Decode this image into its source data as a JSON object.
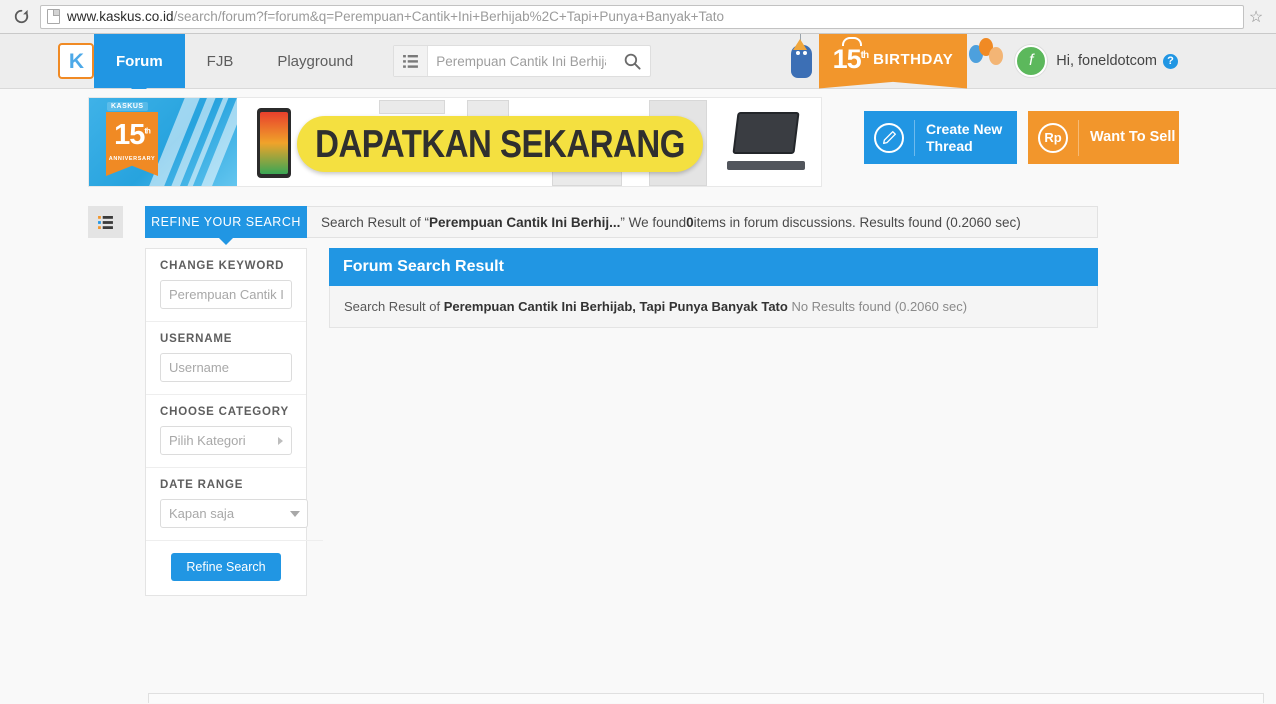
{
  "browser": {
    "reload_icon": "reload-icon",
    "page_icon": "page-icon",
    "url_domain": "www.kaskus.co.id",
    "url_path": "/search/forum?f=forum&q=Perempuan+Cantik+Ini+Berhijab%2C+Tapi+Punya+Banyak+Tato",
    "bookmark_icon": "star-icon"
  },
  "header": {
    "logo": "kaskus-logo",
    "logo_letter": "K",
    "tabs": [
      {
        "label": "Forum",
        "active": true
      },
      {
        "label": "FJB",
        "active": false
      },
      {
        "label": "Playground",
        "active": false
      }
    ],
    "category_icon": "list-icon",
    "search": {
      "placeholder": "Perempuan Cantik Ini Berhija",
      "value": "",
      "submit_icon": "search-icon"
    },
    "mascot_icon": "mascot-icon",
    "birthday": {
      "number": "15",
      "ordinal": "th",
      "word": "BIRTHDAY"
    },
    "balloons_icon": "balloons-icon",
    "avatar": "user-avatar",
    "avatar_letter": "f",
    "greeting": "Hi, foneldotcom",
    "help_icon": "help-icon",
    "help_glyph": "?"
  },
  "banner": {
    "anniversary_tag": "KASKUS",
    "anniversary_number": "15",
    "anniversary_ordinal": "th",
    "anniversary_word": "ANNIVERSARY",
    "cta_text": "DAPATKAN SEKARANG",
    "phone_icon": "phone-image",
    "laptop_icon": "laptop-image"
  },
  "actions": {
    "create_thread": {
      "icon": "pencil-icon",
      "label": "Create New Thread",
      "color": "#2196e3"
    },
    "want_to_sell": {
      "icon": "rupiah-icon",
      "icon_text": "Rp",
      "label": "Want To Sell",
      "color": "#f2962c"
    }
  },
  "toolbar": {
    "viewmode_icon": "list-view-icon",
    "refine_tab_label": "REFINE YOUR SEARCH",
    "summary": {
      "prefix": "Search Result of “",
      "query_short": "Perempuan Cantik Ini Berhij...",
      "middle": "” We found ",
      "count": "0",
      "suffix": " items in forum discussions. Results found (0.2060 sec)"
    }
  },
  "sidebar": {
    "groups": [
      {
        "label": "CHANGE KEYWORD",
        "field": "keyword",
        "placeholder": "Perempuan Cantik Ini Berhijab, Tapi Punya Banyak Tato",
        "value": ""
      },
      {
        "label": "USERNAME",
        "field": "username",
        "placeholder": "Username",
        "value": ""
      },
      {
        "label": "CHOOSE CATEGORY",
        "field": "category",
        "placeholder": "Pilih Kategori",
        "value": ""
      },
      {
        "label": "DATE RANGE",
        "field": "daterange",
        "placeholder": "Kapan saja",
        "value": ""
      }
    ],
    "submit_label": "Refine Search"
  },
  "results": {
    "panel_title": "Forum Search Result",
    "body_prefix": "Search Result of ",
    "body_query": "Perempuan Cantik Ini Berhijab, Tapi Punya Banyak Tato",
    "body_suffix": " No Results found (0.2060 sec)"
  },
  "colors": {
    "brand_blue": "#2196e3",
    "brand_orange": "#f2962c",
    "page_bg": "#f9f9f9",
    "header_bg": "#ededed",
    "cta_yellow": "#f4e040"
  }
}
